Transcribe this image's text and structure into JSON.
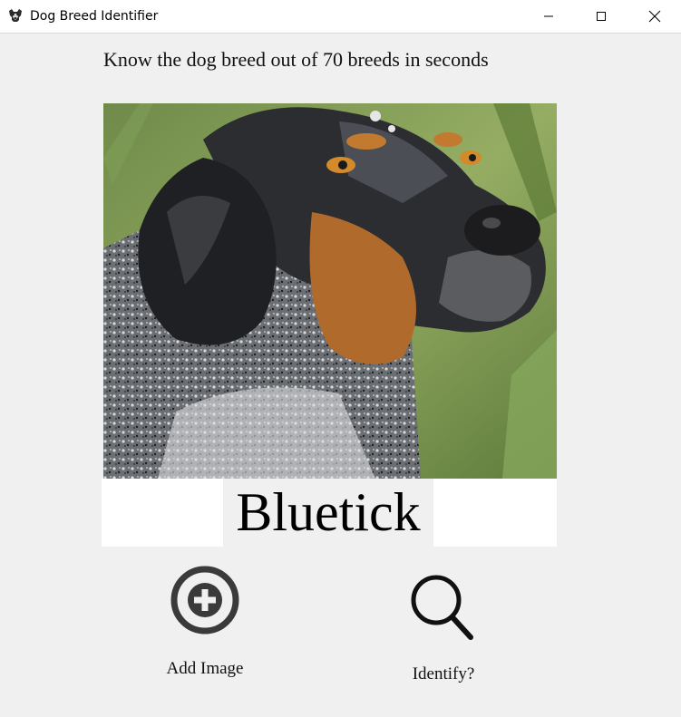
{
  "window": {
    "title": "Dog Breed Identifier",
    "icon": "dog-face-icon",
    "controls": [
      "minimize-icon",
      "maximize-icon",
      "close-icon"
    ]
  },
  "main": {
    "subtitle": "Know the dog breed out of 70 breeds in seconds",
    "image": {
      "description_icon": "dog-photo"
    },
    "result": "Bluetick"
  },
  "actions": {
    "add_image": {
      "label": "Add Image",
      "icon": "plus-circle-icon"
    },
    "identify": {
      "label": "Identify?",
      "icon": "search-icon"
    }
  },
  "colors": {
    "window_bg": "#f0f0f0",
    "titlebar_bg": "#ffffff",
    "icon_dark": "#3a3a3a"
  }
}
